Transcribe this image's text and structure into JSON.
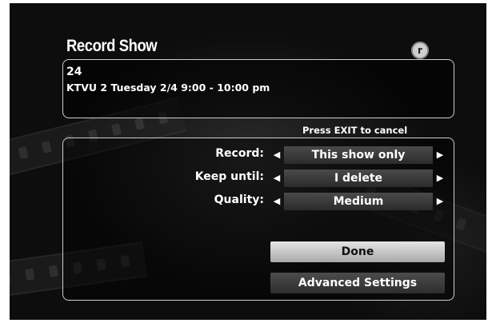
{
  "dialog": {
    "title": "Record Show",
    "logo_icon": "tivo-r-icon",
    "logo_glyph": "r"
  },
  "show": {
    "name": "24",
    "details": "KTVU 2 Tuesday 2/4 9:00 - 10:00 pm"
  },
  "hint": "Press EXIT to cancel",
  "options": [
    {
      "label": "Record:",
      "value": "This show only"
    },
    {
      "label": "Keep until:",
      "value": "I delete"
    },
    {
      "label": "Quality:",
      "value": "Medium"
    }
  ],
  "arrows": {
    "left": "◀",
    "right": "▶"
  },
  "buttons": {
    "done": "Done",
    "advanced": "Advanced Settings"
  },
  "colors": {
    "background": "#0d0d0d",
    "border": "#cfcfcf",
    "highlight": "#d6d6d6"
  }
}
